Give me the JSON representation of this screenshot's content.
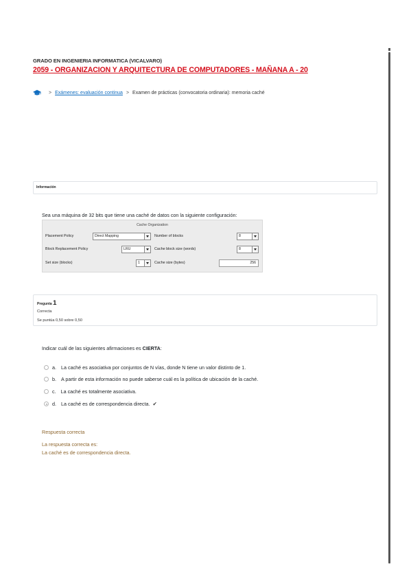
{
  "header": {
    "degree": "GRADO EN INGENIERIA INFORMATICA (VICALVARO)",
    "course": "2059 - ORGANIZACION Y ARQUITECTURA DE COMPUTADORES - MAÑANA A - 20"
  },
  "breadcrumb": {
    "icon": "graduation-cap-icon",
    "link": "Exámenes: evaluación continua",
    "current": "Examen de prácticas (convocatoria ordinaria): memoria caché",
    "separator": ">"
  },
  "info": {
    "label": "Información"
  },
  "intro_text": "Sea una máquina de 32 bits que tiene una caché de datos con la siguiente configuración:",
  "cache": {
    "title": "Cache Organization",
    "placement_policy_label": "Placement Policy",
    "placement_policy_value": "Direct Mapping",
    "block_replacement_label": "Block Replacement Policy",
    "block_replacement_value": "LRU",
    "set_size_label": "Set size (blocks)",
    "set_size_value": "1",
    "num_blocks_label": "Number of blocks",
    "num_blocks_value": "8",
    "block_size_label": "Cache block size (words)",
    "block_size_value": "8",
    "cache_size_label": "Cache size (bytes)",
    "cache_size_value": "256"
  },
  "question": {
    "label_prefix": "Pregunta",
    "number": "1",
    "state": "Correcta",
    "grade": "Se puntúa 0,50 sobre 0,50",
    "text_prefix": "Indicar cuál de las siguientes afirmaciones es ",
    "text_emph": "CIERTA",
    "text_suffix": ":",
    "options": [
      {
        "letter": "a.",
        "text": "La caché es asociativa por conjuntos de N vías, donde N tiene un valor distinto de 1.",
        "selected": false
      },
      {
        "letter": "b.",
        "text": "A partir de esta información no puede saberse cuál es la política de ubicación de la caché.",
        "selected": false
      },
      {
        "letter": "c.",
        "text": "La caché es totalmente asociativa.",
        "selected": false
      },
      {
        "letter": "d.",
        "text": "La caché es de correspondencia directa.",
        "selected": true
      }
    ],
    "check_mark": "✔"
  },
  "feedback": {
    "result": "Respuesta correcta",
    "correct_intro": "La respuesta correcta es:",
    "correct_answer": "La caché es de correspondencia directa."
  },
  "colors": {
    "course_red": "#d50f1c",
    "link_blue": "#0f6cbf",
    "feedback_brown": "#8e662e"
  }
}
